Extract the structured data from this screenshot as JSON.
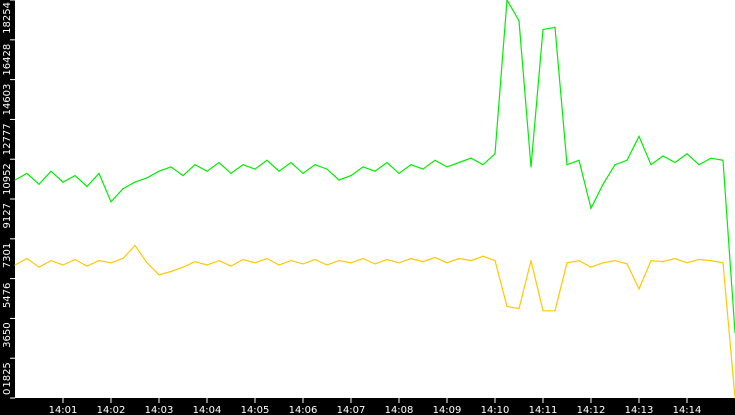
{
  "chart_data": {
    "type": "line",
    "title": "",
    "xlabel": "",
    "ylabel": "",
    "x_unit": "minutes after 14:00",
    "xlim": [
      0,
      15
    ],
    "ylim": [
      0,
      18254
    ],
    "grid": false,
    "y_ticks": [
      "0",
      "1825",
      "3650",
      "5476",
      "7301",
      "9127",
      "10952",
      "12777",
      "14603",
      "16428",
      "18254"
    ],
    "y_tick_values": [
      0,
      1825,
      3650,
      5476,
      7301,
      9127,
      10952,
      12777,
      14603,
      16428,
      18254
    ],
    "x_ticks": [
      "14:01",
      "14:02",
      "14:03",
      "14:04",
      "14:05",
      "14:06",
      "14:07",
      "14:08",
      "14:09",
      "14:10",
      "14:11",
      "14:12",
      "14:13",
      "14:14"
    ],
    "x_tick_values": [
      1,
      2,
      3,
      4,
      5,
      6,
      7,
      8,
      9,
      10,
      11,
      12,
      13,
      14
    ],
    "x_step": 0.25,
    "series": [
      {
        "name": "green",
        "color": "#00ee00",
        "values": [
          10000,
          10300,
          9800,
          10400,
          9900,
          10200,
          9700,
          10300,
          9000,
          9600,
          9900,
          10100,
          10400,
          10600,
          10200,
          10700,
          10400,
          10800,
          10300,
          10700,
          10500,
          10900,
          10400,
          10800,
          10300,
          10700,
          10500,
          10000,
          10200,
          10600,
          10400,
          10800,
          10300,
          10700,
          10500,
          10900,
          10600,
          10800,
          11000,
          10700,
          11200,
          18254,
          17300,
          10600,
          16900,
          17000,
          10700,
          10900,
          8700,
          9800,
          10700,
          10900,
          12000,
          10700,
          11100,
          10800,
          11200,
          10700,
          11000,
          10900,
          3000
        ]
      },
      {
        "name": "yellow",
        "color": "#ffc800",
        "values": [
          6100,
          6400,
          6000,
          6300,
          6100,
          6350,
          6050,
          6300,
          6200,
          6400,
          7000,
          6200,
          5650,
          5800,
          6000,
          6250,
          6100,
          6300,
          6050,
          6350,
          6200,
          6400,
          6100,
          6300,
          6150,
          6350,
          6100,
          6300,
          6200,
          6400,
          6150,
          6350,
          6200,
          6400,
          6250,
          6450,
          6200,
          6400,
          6300,
          6500,
          6300,
          4200,
          4100,
          6300,
          4000,
          4000,
          6200,
          6300,
          6000,
          6200,
          6300,
          6150,
          5000,
          6300,
          6250,
          6400,
          6200,
          6350,
          6300,
          6200,
          0
        ]
      }
    ]
  }
}
